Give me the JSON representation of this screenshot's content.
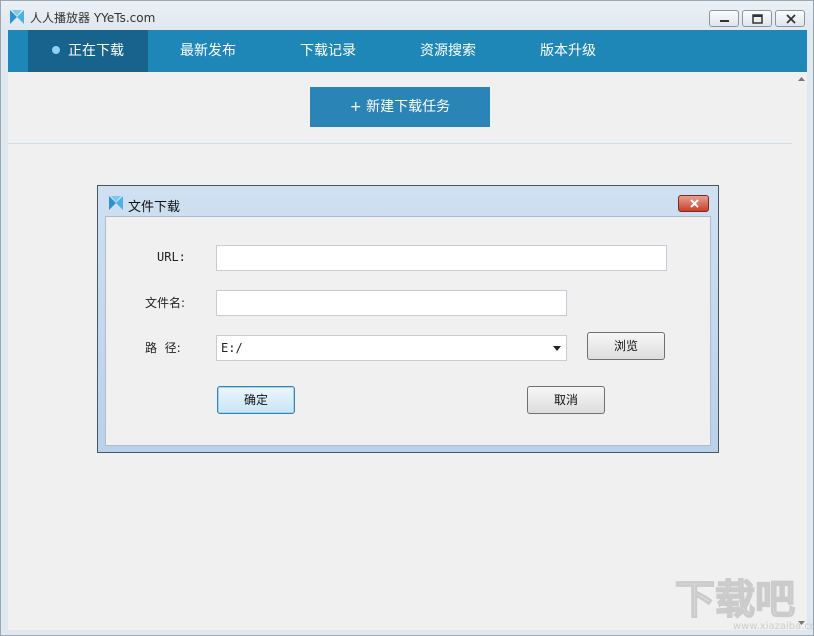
{
  "app": {
    "title": "人人播放器 YYeTs.com"
  },
  "nav": {
    "tabs": [
      {
        "label": "正在下载",
        "active": true
      },
      {
        "label": "最新发布"
      },
      {
        "label": "下载记录"
      },
      {
        "label": "资源搜索"
      },
      {
        "label": "版本升级"
      }
    ]
  },
  "toolbar": {
    "new_task_label": "+ 新建下载任务"
  },
  "dialog": {
    "title": "文件下载",
    "url_label": "URL:",
    "url_value": "",
    "filename_label": "文件名:",
    "filename_value": "",
    "path_label": "路  径:",
    "path_value": "E:/",
    "browse_label": "浏览",
    "ok_label": "确定",
    "cancel_label": "取消"
  },
  "watermark": {
    "text": "下载吧",
    "url": "www.xiazaiba.com"
  },
  "colors": {
    "nav_bg": "#1e87b8",
    "nav_active": "#18638e",
    "new_task_bg": "#2a84b6"
  }
}
